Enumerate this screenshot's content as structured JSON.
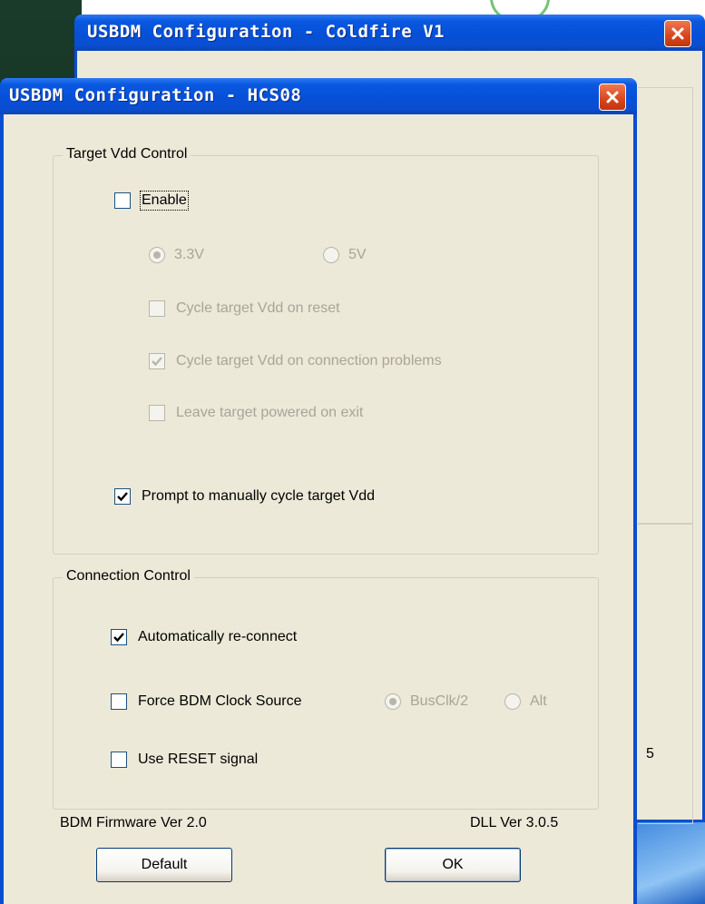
{
  "back_window": {
    "title": "USBDM Configuration - Coldfire V1",
    "fragment_text": "5"
  },
  "dialog": {
    "title": "USBDM Configuration - HCS08",
    "target_vdd": {
      "group_label": "Target Vdd Control",
      "enable": {
        "label": "Enable",
        "checked": false
      },
      "voltage_options": [
        {
          "label": "3.3V",
          "selected": true
        },
        {
          "label": "5V",
          "selected": false
        }
      ],
      "cycle_on_reset": {
        "label": "Cycle target Vdd on reset",
        "checked": false
      },
      "cycle_on_problems": {
        "label": "Cycle target Vdd on connection problems",
        "checked": true
      },
      "leave_powered": {
        "label": "Leave target powered on exit",
        "checked": false
      },
      "prompt_manual": {
        "label": "Prompt to manually cycle target Vdd",
        "checked": true
      }
    },
    "connection": {
      "group_label": "Connection Control",
      "auto_reconnect": {
        "label": "Automatically re-connect",
        "checked": true
      },
      "force_clock": {
        "label": "Force BDM Clock Source",
        "checked": false
      },
      "clock_options": [
        {
          "label": "BusClk/2",
          "selected": true
        },
        {
          "label": "Alt",
          "selected": false
        }
      ],
      "use_reset": {
        "label": "Use RESET signal",
        "checked": false
      }
    },
    "footer": {
      "firmware": "BDM Firmware Ver 2.0",
      "dll": "DLL Ver 3.0.5"
    },
    "buttons": {
      "default_label": "Default",
      "ok_label": "OK"
    }
  },
  "colors": {
    "titlebar": "#0650d8",
    "dialog_bg": "#ece9d8",
    "close_button": "#d8451c",
    "disabled_text": "#a7a59a"
  }
}
